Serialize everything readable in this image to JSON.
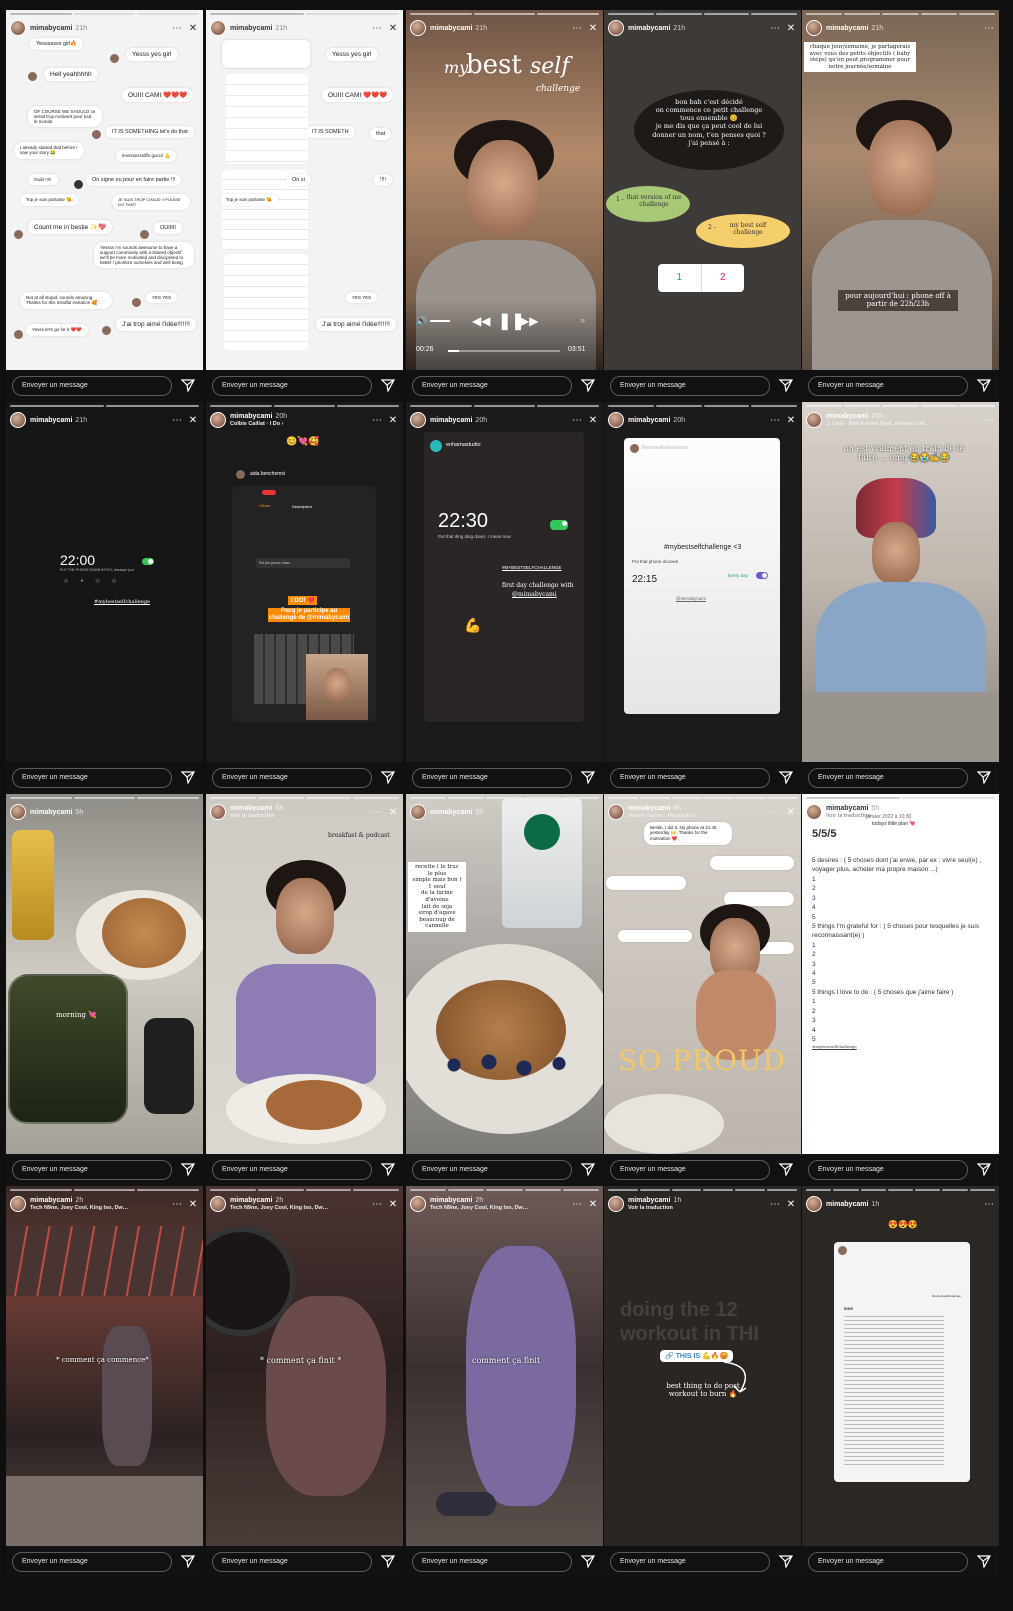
{
  "footer": {
    "message_placeholder": "Envoyer un message"
  },
  "stories": [
    {
      "user": "mimabycami",
      "time": "21h",
      "subtitle": "",
      "bubbles": [
        "Yesssssss girl🔥",
        "Yesss yes girl",
        "Hell yeahhhhh",
        "OUIII CAMI ❤️❤️❤️",
        "OF COURSE WE SHOULD ce serait trop motivant pour tout le monde",
        "IT IS SOMETHING let's do that",
        "I already started that before I saw your story 😂",
        "tessssesstdlfo gucci! 💪",
        "Ouiiii !!!!!",
        "On signe ou pour en faire partie !!!",
        "Top je suis partante 😘",
        "JE SUIS TROP CHAUD !! PLEASE DO THAT!",
        "Count me in bestie ✨💖",
        "OUIIIII",
        "Yessss I'm sounds awesome to have a support community with a shared objectif we'll be more motivated and disciplined to better / prioritize ourselves and well being",
        "Not at all stupid, sounds amazing. Thanks for this mindful invitation 🥰",
        "YES YES",
        "J'ai trop aimé l'idée!!!!!!!",
        "Yesss let's go for it ❤️❤️"
      ]
    },
    {
      "user": "mimabycami",
      "time": "21h",
      "subtitle": "",
      "bubbles": [
        "Yesss yes girl",
        "OUIII CAMI ❤️❤️❤️",
        "IT IS SOMETH",
        "that",
        "On si",
        "!!!!",
        "Top je suis partante 😘",
        "YES YES",
        "J'ai trop aimé l'idée!!!!!!!"
      ]
    },
    {
      "user": "mimabycami",
      "time": "21h",
      "subtitle": "",
      "sticker": {
        "my": "my",
        "best": "best",
        "self": "self",
        "challenge": "challenge"
      },
      "player": {
        "elapsed": "00:26",
        "total": "03:51"
      }
    },
    {
      "user": "mimabycami",
      "time": "21h",
      "subtitle": "",
      "lines": [
        "bon bah c'est décidé",
        "on commence ce petit challenge",
        "tous ensemble 😊",
        "je me dis que ça peut cool de lui",
        "donner un nom, t'en penses quoi ?",
        "j'ai pensé à :"
      ],
      "option1": "that version of me challenge",
      "option2": "my best self challenge",
      "poll": [
        "1",
        "2"
      ]
    },
    {
      "user": "mimabycami",
      "time": "21h",
      "subtitle": "",
      "top_text": "chaque jour/semaine, je partagerais avec vous des petits objectifs ( baby steps) qu'on peut programmer pour notre journée/semaine",
      "bottom_text": "pour aujourd'hui : phone off à partir de 22h/23h"
    },
    {
      "user": "mimabycami",
      "time": "21h",
      "subtitle": "",
      "clock": "22:00",
      "clock_sub": "PUT THE PHONE DOWN BITCH, cheaque jour",
      "tag": "#mybestselfchallenge"
    },
    {
      "user": "mimabycami",
      "time": "20h",
      "subtitle": "Colbie Caillat · I Do ›",
      "emojis": "😊💘🥰",
      "reposter": "aida.benchemsi",
      "screen_title": "Description",
      "screen_back": "‹ Retour",
      "field": "Put the phone down",
      "badge": "I DO! ❤️",
      "caption": "Pacq je participe au challenge de @mimabycami"
    },
    {
      "user": "mimabycami",
      "time": "20h",
      "subtitle": "",
      "studio": "enhamastudio",
      "clock": "22:30",
      "clock_sub": "Put that ding ding down, I mean now",
      "tag": "#MYBESTSELFCHALLENGE",
      "line1": "first day challenge with",
      "mention": "@mimabycami"
    },
    {
      "user": "mimabycami",
      "time": "20h",
      "subtitle": "",
      "reposter": "thesnowflakeslesson",
      "tag": "#mybestselfchallenge <3",
      "sub": "Put that phone dooown",
      "clock": "22:15",
      "every": "Every day",
      "mention": "@mimabycami"
    },
    {
      "user": "mimabycami",
      "time": "20h",
      "subtitle": "J. Cole · She Knows (feat. Amber Coff…",
      "caption": "on est vraiment en train de le faire ... omg 😂😭✍️😂"
    },
    {
      "user": "mimabycami",
      "time": "5h",
      "subtitle": "",
      "caption": "morning 💘"
    },
    {
      "user": "mimabycami",
      "time": "5h",
      "subtitle": "Voir la traduction",
      "caption": "breakfast & podcast"
    },
    {
      "user": "mimabycami",
      "time": "5h",
      "subtitle": "",
      "recipe": [
        "recette ( le truc le plus",
        "simple mais bon )",
        "1 oeuf",
        "de la farine d'avoine",
        "lait de soja",
        "sirop d'agave",
        "beaucoup de cannelle"
      ]
    },
    {
      "user": "mimabycami",
      "time": "5h",
      "subtitle": "Jessie Taylor · Mountains ›",
      "reply": "Bestie, I did it. No phone at 21:45 yesterday 🙌. Thanks for the motivation ❤️.",
      "big": "SO PROUD"
    },
    {
      "user": "mimabycami",
      "time": "5h",
      "subtitle": "Voir la traduction",
      "date_line": "janvier 2022 à 10:30",
      "plan": "todays little plan 💘",
      "heading": "5/5/5",
      "sections": [
        {
          "title": "5 desires : ( 5 choses dont j'ai envie, par ex : vivre seul(e) , voyager plus, acheter ma propre maison ...)",
          "items": [
            "1",
            "2",
            "3",
            "4",
            "5"
          ]
        },
        {
          "title": "5 things I'm grateful for : ( 5 choses pour lesquelles je suis reconnaissant(e) )",
          "items": [
            "1",
            "2",
            "3",
            "4",
            "5"
          ]
        },
        {
          "title": "5 things I love to do : ( 5 choses que j'aime faire )",
          "items": [
            "1",
            "2",
            "3",
            "4",
            "5"
          ]
        }
      ],
      "tag": "#mybestselfchallenge"
    },
    {
      "user": "mimabycami",
      "time": "2h",
      "subtitle": "Tech N9ne, Joey Cool, King Iso, Dw…",
      "caption": "* comment ça commence*"
    },
    {
      "user": "mimabycami",
      "time": "2h",
      "subtitle": "Tech N9ne, Joey Cool, King Iso, Dw…",
      "caption": "* comment ça finit *"
    },
    {
      "user": "mimabycami",
      "time": "2h",
      "subtitle": "Tech N9ne, Joey Cool, King Iso, Dw…",
      "caption": "comment ça finit"
    },
    {
      "user": "mimabycami",
      "time": "1h",
      "subtitle": "Voir la traduction",
      "ghost": "doing the 12 workout in THI",
      "link": "🔗 THIS IS 💪🔥😡",
      "caption": "best thing to do post workout to burn 🔥"
    },
    {
      "user": "mimabycami",
      "time": "1h",
      "subtitle": "",
      "emojis": "😍😍😍",
      "doc_heading": "5/5/5",
      "doc_tag": "#mybestselfchallenge"
    }
  ],
  "colors": {
    "accent_green": "#34c759",
    "bubble_yellow": "#f6cf6d",
    "poll_red": "#e0245e",
    "badge_orange": "#ff8a00"
  }
}
